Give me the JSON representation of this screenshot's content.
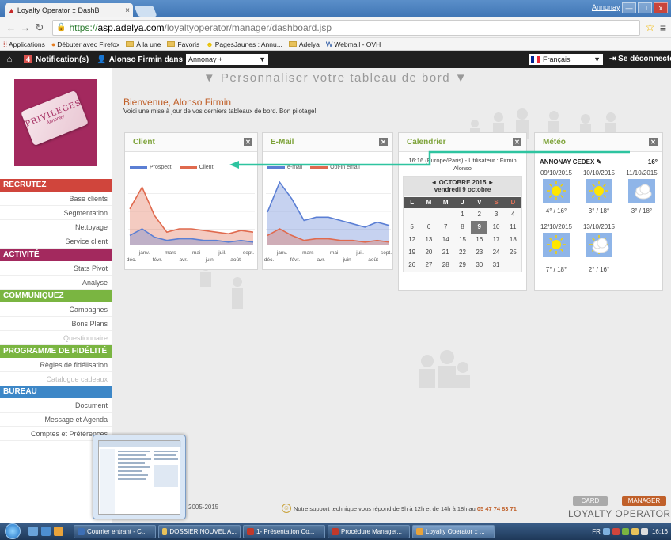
{
  "browser": {
    "tab_title": "Loyalty Operator :: DashB",
    "tab_close": "×",
    "window_user": "Annonay",
    "controls": {
      "minimize": "—",
      "maximize": "□",
      "close": "x"
    },
    "url": {
      "protocol": "https://",
      "domain": "asp.adelya.com",
      "path": "/loyaltyoperator/manager/dashboard.jsp"
    },
    "bookmarks": [
      "Applications",
      "Débuter avec Firefox",
      "À la une",
      "Favoris",
      "PagesJaunes : Annu...",
      "Adelya",
      "Webmail - OVH"
    ]
  },
  "topbar": {
    "notification_count": "4",
    "notification_label": "Notification(s)",
    "user_text": "Alonso Firmin dans",
    "city_select": "Annonay +",
    "language": "Français",
    "logout": "Se déconnecter"
  },
  "personalize": "▼ Personnaliser votre tableau de bord ▼",
  "logo": {
    "title": "PRIVILEGES",
    "subtitle": "Annonay"
  },
  "sidebar": {
    "sections": [
      {
        "label": "RECRUTEZ",
        "color": "#d0453c",
        "items": [
          {
            "label": "Base clients"
          },
          {
            "label": "Segmentation"
          },
          {
            "label": "Nettoyage"
          },
          {
            "label": "Service client"
          }
        ]
      },
      {
        "label": "ACTIVITÉ",
        "color": "#a3295e",
        "items": [
          {
            "label": "Stats Pivot"
          },
          {
            "label": "Analyse"
          }
        ]
      },
      {
        "label": "COMMUNIQUEZ",
        "color": "#7ab541",
        "items": [
          {
            "label": "Campagnes"
          },
          {
            "label": "Bons Plans"
          },
          {
            "label": "Questionnaire",
            "dim": true
          }
        ]
      },
      {
        "label": "PROGRAMME DE FIDÉLITÉ",
        "color": "#7ab541",
        "items": [
          {
            "label": "Règles de fidélisation"
          },
          {
            "label": "Catalogue cadeaux",
            "dim": true
          }
        ]
      },
      {
        "label": "BUREAU",
        "color": "#3d87c7",
        "items": [
          {
            "label": "Document"
          },
          {
            "label": "Message et Agenda"
          },
          {
            "label": "Comptes et Préférences"
          }
        ]
      }
    ]
  },
  "welcome": {
    "prefix": "Bienvenue,",
    "name": "Alonso Firmin",
    "subtitle": "Voici une mise à jour de vos derniers tableaux de bord. Bon pilotage!"
  },
  "widgets": {
    "client": {
      "title": "Client",
      "close": "✕"
    },
    "email": {
      "title": "E-Mail",
      "close": "✕"
    },
    "calendar": {
      "title": "Calendrier",
      "close": "✕"
    },
    "meteo": {
      "title": "Météo",
      "close": "✕"
    }
  },
  "chart_data": [
    {
      "type": "area",
      "title": "Client",
      "categories": [
        "déc.",
        "janv.",
        "févr.",
        "mars",
        "avr.",
        "mai",
        "juin",
        "juil.",
        "août",
        "sept."
      ],
      "series": [
        {
          "name": "Prospect",
          "color": "#5b7fd4",
          "values": [
            6,
            10,
            5,
            3,
            4,
            4,
            3,
            3,
            2,
            3,
            2
          ]
        },
        {
          "name": "Client",
          "color": "#e06a4e",
          "values": [
            22,
            35,
            18,
            8,
            10,
            10,
            9,
            8,
            7,
            9,
            8
          ]
        }
      ],
      "ylim": [
        0,
        40
      ]
    },
    {
      "type": "area",
      "title": "E-Mail",
      "categories": [
        "déc.",
        "janv.",
        "févr.",
        "mars",
        "avr.",
        "mai",
        "juin",
        "juil.",
        "août",
        "sept."
      ],
      "series": [
        {
          "name": "e-mail",
          "color": "#5b7fd4",
          "values": [
            20,
            38,
            28,
            15,
            17,
            17,
            15,
            13,
            11,
            14,
            12
          ]
        },
        {
          "name": "Opt-in email",
          "color": "#e06a4e",
          "values": [
            6,
            10,
            6,
            3,
            4,
            4,
            3,
            3,
            2,
            3,
            2
          ]
        }
      ],
      "ylim": [
        0,
        40
      ]
    }
  ],
  "calendar": {
    "tz_line": "16:16 (Europe/Paris) - Utilisateur : Firmin Alonso",
    "month": "◄ OCTOBRE 2015 ►",
    "day": "vendredi 9 octobre",
    "day_names": [
      "L",
      "M",
      "M",
      "J",
      "V",
      "S",
      "D"
    ],
    "weeks": [
      [
        "",
        "",
        "",
        "1",
        "2",
        "3",
        "4"
      ],
      [
        "5",
        "6",
        "7",
        "8",
        "9",
        "10",
        "11"
      ],
      [
        "12",
        "13",
        "14",
        "15",
        "16",
        "17",
        "18"
      ],
      [
        "19",
        "20",
        "21",
        "22",
        "23",
        "24",
        "25"
      ],
      [
        "26",
        "27",
        "28",
        "29",
        "30",
        "31",
        ""
      ]
    ],
    "today": "9"
  },
  "meteo": {
    "location": "ANNONAY CEDEX",
    "current": "16°",
    "days": [
      {
        "date": "09/10/2015",
        "icon": "sun-icon",
        "temp": "4° / 16°"
      },
      {
        "date": "10/10/2015",
        "icon": "sun-icon",
        "temp": "3° / 18°"
      },
      {
        "date": "11/10/2015",
        "icon": "cloud-icon",
        "temp": "3° / 18°"
      },
      {
        "date": "12/10/2015",
        "icon": "sun-icon",
        "temp": "7° / 18°"
      },
      {
        "date": "13/10/2015",
        "icon": "sun-cloud-icon",
        "temp": "2° / 16°"
      }
    ]
  },
  "footer": {
    "copyright": "2005-2015",
    "support_text": "Notre support technique vous répond de 9h à 12h et de 14h à 18h au",
    "phone": "05 47 74 83 71",
    "card": "CARD",
    "manager": "MANAGER",
    "brand": "LOYALTY OPERATOR"
  },
  "taskbar": {
    "buttons": [
      {
        "label": "Courrier entrant - C...",
        "color": "#3d6fb5"
      },
      {
        "label": "DOSSIER NOUVEL A...",
        "color": "#e8c25b"
      },
      {
        "label": "1- Présentation Co...",
        "color": "#c0392b"
      },
      {
        "label": "Procédure Manager...",
        "color": "#c0392b"
      },
      {
        "label": "Loyalty Operator :: ...",
        "color": "#e8a33b",
        "active": true
      }
    ],
    "lang": "FR",
    "time": "16:16"
  }
}
